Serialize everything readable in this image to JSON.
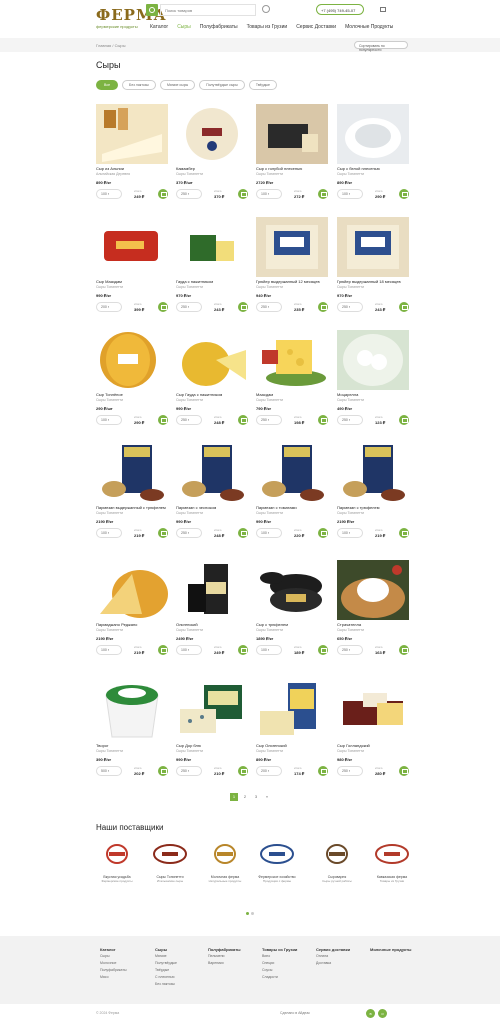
{
  "header": {
    "logo": "ФЕРМА",
    "search_placeholder": "Поиск товаров",
    "phone": "+7 (495) 749-45-07",
    "nav": [
      "Каталог",
      "Сыры",
      "Полуфабрикаты",
      "Товары из Грузии",
      "Сервис Доставки",
      "Молочные Продукты"
    ]
  },
  "breadcrumb": [
    "Главная",
    "Сыры"
  ],
  "sort_label": "Сортировать по популярности",
  "page_title": "Сыры",
  "filters": [
    "Все",
    "Без лактозы",
    "Мягкие сыры",
    "Полутвёрдые сыры",
    "Твёрдые"
  ],
  "products": [
    {
      "name": "Сыр из Альпии",
      "supplier": "Альпийская Деревня",
      "price": "890 ₽/кг",
      "qty": "100 г",
      "total": "249 ₽",
      "img": "brie"
    },
    {
      "name": "Камамбер",
      "supplier": "Сыры Тонинетти",
      "price": "370 ₽/шт",
      "qty": "250 г",
      "total": "370 ₽",
      "img": "round"
    },
    {
      "name": "Сыр с голубой плесенью",
      "supplier": "Сыры Тонинетти",
      "price": "2720 ₽/кг",
      "qty": "100 г",
      "total": "272 ₽",
      "img": "dark"
    },
    {
      "name": "Сыр с белой плесенью",
      "supplier": "Сыры Тонинетти",
      "price": "890 ₽/кг",
      "qty": "100 г",
      "total": "290 ₽",
      "img": "white"
    },
    {
      "name": "Сыр Мааздам",
      "supplier": "Сыры Тонинетти",
      "price": "990 ₽/кг",
      "qty": "200 г",
      "total": "399 ₽",
      "img": "red"
    },
    {
      "name": "Гауда с пажитником",
      "supplier": "Сыры Тонинетти",
      "price": "970 ₽/кг",
      "qty": "250 г",
      "total": "243 ₽",
      "img": "green"
    },
    {
      "name": "Грюйер выдержанный 12 месяцев",
      "supplier": "Сыры Тонинетти",
      "price": "940 ₽/кг",
      "qty": "250 г",
      "total": "235 ₽",
      "img": "block"
    },
    {
      "name": "Грюйер выдержанный 18 месяцев",
      "supplier": "Сыры Тонинетти",
      "price": "970 ₽/кг",
      "qty": "250 г",
      "total": "243 ₽",
      "img": "block"
    },
    {
      "name": "Сыр Топлёное",
      "supplier": "Сыры Тонинетти",
      "price": "290 ₽/шт",
      "qty": "100 г",
      "total": "290 ₽",
      "img": "yellowball"
    },
    {
      "name": "Сыр Гауда с пажитником",
      "supplier": "Сыры Тонинетти",
      "price": "990 ₽/кг",
      "qty": "250 г",
      "total": "248 ₽",
      "img": "yellowwedge"
    },
    {
      "name": "Маасдам",
      "supplier": "Сыры Тонинетти",
      "price": "790 ₽/кг",
      "qty": "250 г",
      "total": "198 ₽",
      "img": "swiss"
    },
    {
      "name": "Моцарелла",
      "supplier": "Сыры Тонинетти",
      "price": "490 ₽/кг",
      "qty": "250 г",
      "total": "123 ₽",
      "img": "mozz"
    },
    {
      "name": "Пармезан выдержанный с трюфелем",
      "supplier": "Сыры Тонинетти",
      "price": "2190 ₽/кг",
      "qty": "100 г",
      "total": "219 ₽",
      "img": "jar"
    },
    {
      "name": "Пармезан с чесноком",
      "supplier": "Сыры Тонинетти",
      "price": "990 ₽/кг",
      "qty": "250 г",
      "total": "248 ₽",
      "img": "jar"
    },
    {
      "name": "Пармезан с томатами",
      "supplier": "Сыры Тонинетти",
      "price": "990 ₽/кг",
      "qty": "100 г",
      "total": "220 ₽",
      "img": "jar"
    },
    {
      "name": "Пармезан с трюфелем",
      "supplier": "Сыры Тонинетти",
      "price": "2190 ₽/кг",
      "qty": "100 г",
      "total": "219 ₽",
      "img": "jar"
    },
    {
      "name": "Пармиджано Реджано",
      "supplier": "Сыры Тонинетти",
      "price": "2190 ₽/кг",
      "qty": "100 г",
      "total": "219 ₽",
      "img": "parm"
    },
    {
      "name": "Ольтенский",
      "supplier": "Сыры Тонинетти",
      "price": "2490 ₽/кг",
      "qty": "100 г",
      "total": "249 ₽",
      "img": "box"
    },
    {
      "name": "Сыр с трюфелем",
      "supplier": "Сыры Тонинетти",
      "price": "1890 ₽/кг",
      "qty": "100 г",
      "total": "189 ₽",
      "img": "blackwheel"
    },
    {
      "name": "Страчателла",
      "supplier": "Сыры Тонинетти",
      "price": "650 ₽/кг",
      "qty": "250 г",
      "total": "163 ₽",
      "img": "plate"
    },
    {
      "name": "Творог",
      "supplier": "Сыры Тонинетти",
      "price": "390 ₽/кг",
      "qty": "500 г",
      "total": "202 ₽",
      "img": "tub"
    },
    {
      "name": "Сыр Дор блю",
      "supplier": "Сыры Тонинетти",
      "price": "990 ₽/кг",
      "qty": "250 г",
      "total": "210 ₽",
      "img": "greenbox"
    },
    {
      "name": "Сыр Ольтенский",
      "supplier": "Сыры Тонинетти",
      "price": "890 ₽/кг",
      "qty": "200 г",
      "total": "174 ₽",
      "img": "bluebox"
    },
    {
      "name": "Сыр Голландский",
      "supplier": "Сыры Тонинетти",
      "price": "980 ₽/кг",
      "qty": "250 г",
      "total": "280 ₽",
      "img": "bar"
    }
  ],
  "pagination": [
    "1",
    "2",
    "3",
    "»"
  ],
  "suppliers_title": "Наши поставщики",
  "suppliers": [
    {
      "name": "Вкусная усадьба",
      "desc": "Фермерские продукты"
    },
    {
      "name": "Сыры Тонинетти",
      "desc": "Итальянские сыры"
    },
    {
      "name": "Молочная ферма",
      "desc": "Натуральные продукты"
    },
    {
      "name": "Фермерское хозяйство",
      "desc": "Продукция с фермы"
    },
    {
      "name": "Сыроварня",
      "desc": "Сыры ручной работы"
    },
    {
      "name": "Кавказская ферма",
      "desc": "Товары из Грузии"
    }
  ],
  "footer": {
    "cols": [
      {
        "title": "Каталог",
        "items": [
          "Сыры",
          "Молочное",
          "Полуфабрикаты",
          "Мясо"
        ]
      },
      {
        "title": "Сыры",
        "items": [
          "Мягкие",
          "Полутвёрдые",
          "Твёрдые",
          "С плесенью",
          "Без лактозы"
        ]
      },
      {
        "title": "Полуфабрикаты",
        "items": [
          "Пельмени",
          "Вареники"
        ]
      },
      {
        "title": "Товары из Грузии",
        "items": [
          "Вино",
          "Специи",
          "Соусы",
          "Сладости"
        ]
      },
      {
        "title": "Сервис доставки",
        "items": [
          "Оплата",
          "Доставка"
        ]
      },
      {
        "title": "Молочные продукты",
        "items": []
      }
    ],
    "copyright": "© 2024 Ферма",
    "made_by": "Сделано в Айдеас"
  },
  "colors": {
    "accent": "#7cb342",
    "brand": "#8a6a1c"
  }
}
